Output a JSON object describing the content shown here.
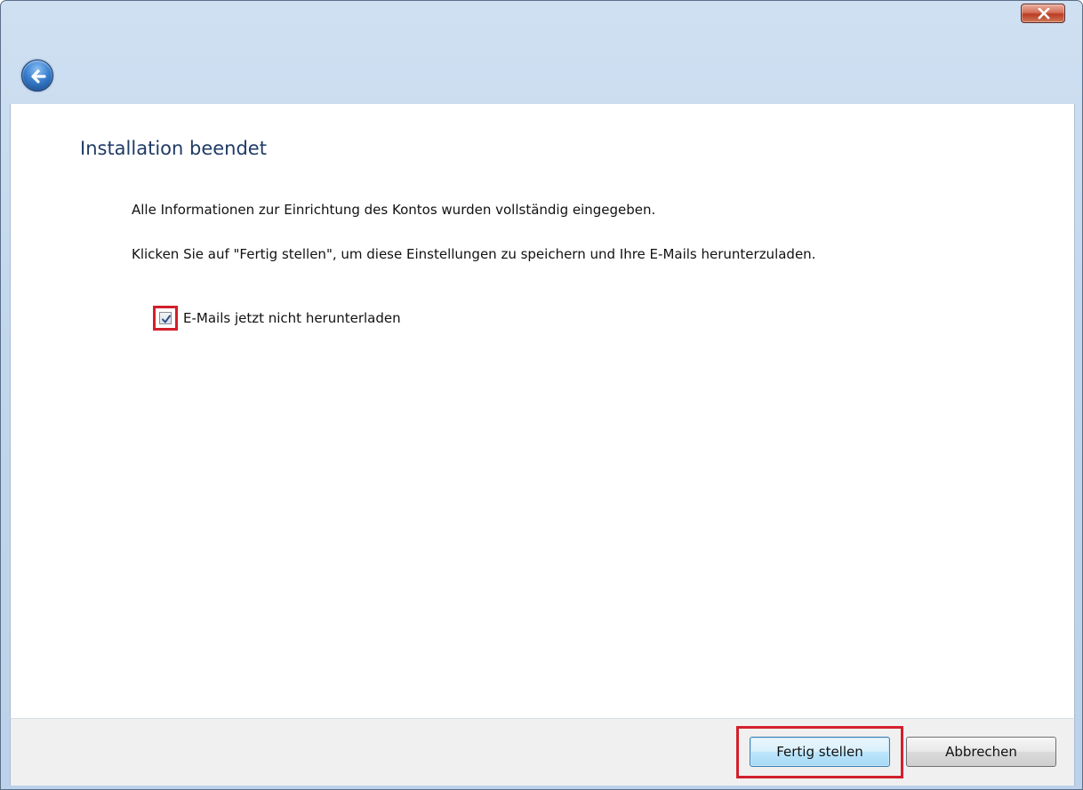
{
  "window": {
    "close_icon": "close-icon",
    "back_icon": "back-arrow-icon"
  },
  "main": {
    "title": "Installation beendet",
    "paragraph1": "Alle Informationen zur Einrichtung des Kontos wurden vollständig eingegeben.",
    "paragraph2": "Klicken Sie auf \"Fertig stellen\", um diese Einstellungen zu speichern und Ihre E-Mails herunterzuladen.",
    "checkbox": {
      "label": "E-Mails jetzt nicht herunterladen",
      "checked": true
    }
  },
  "footer": {
    "finish_label": "Fertig stellen",
    "cancel_label": "Abbrechen"
  },
  "colors": {
    "title_text": "#1f3b66",
    "highlight": "#d2202c",
    "frame": "#c2d6ec"
  }
}
